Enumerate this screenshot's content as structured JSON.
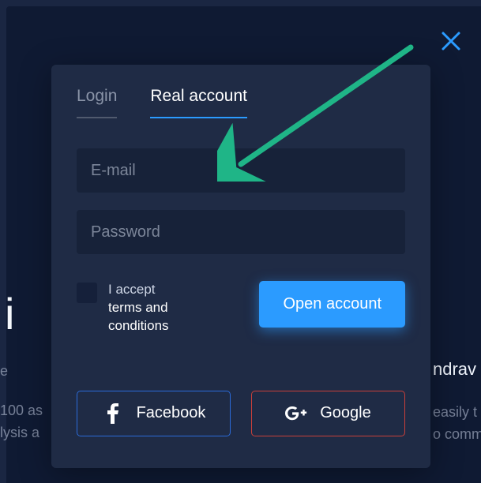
{
  "close": "×",
  "tabs": {
    "login": "Login",
    "real": "Real account"
  },
  "fields": {
    "email_placeholder": "E-mail",
    "password_placeholder": "Password"
  },
  "terms": {
    "prefix": "I accept",
    "link": "terms and conditions"
  },
  "open_button": "Open account",
  "social": {
    "facebook": "Facebook",
    "google": "Google"
  },
  "bg": {
    "heading": "w i",
    "line1": "e",
    "line2": "100 as",
    "line3": "lysis a",
    "right1": "ndrav",
    "right2": "easily t",
    "right3": "o comm"
  }
}
